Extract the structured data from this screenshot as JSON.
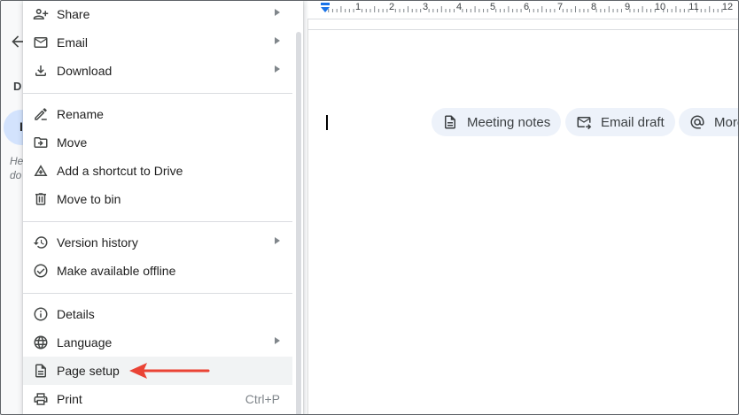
{
  "menu": {
    "items": [
      {
        "label": "Share",
        "icon": "person-add-icon",
        "submenu": true
      },
      {
        "label": "Email",
        "icon": "mail-icon",
        "submenu": true
      },
      {
        "label": "Download",
        "icon": "download-icon",
        "submenu": true
      },
      {
        "label": "Rename",
        "icon": "edit-icon",
        "submenu": false
      },
      {
        "label": "Move",
        "icon": "folder-move-icon",
        "submenu": false
      },
      {
        "label": "Add a shortcut to Drive",
        "icon": "drive-shortcut-icon",
        "submenu": false
      },
      {
        "label": "Move to bin",
        "icon": "trash-icon",
        "submenu": false
      },
      {
        "label": "Version history",
        "icon": "history-icon",
        "submenu": true
      },
      {
        "label": "Make available offline",
        "icon": "offline-check-icon",
        "submenu": false
      },
      {
        "label": "Details",
        "icon": "info-icon",
        "submenu": false
      },
      {
        "label": "Language",
        "icon": "globe-icon",
        "submenu": true
      },
      {
        "label": "Page setup",
        "icon": "page-icon",
        "submenu": false,
        "highlighted": true
      },
      {
        "label": "Print",
        "icon": "print-icon",
        "submenu": false,
        "shortcut": "Ctrl+P"
      }
    ]
  },
  "ruler": {
    "numbers": [
      "1",
      "2",
      "3",
      "4",
      "5",
      "6",
      "7",
      "8",
      "9",
      "10",
      "11",
      "12"
    ]
  },
  "chips": [
    {
      "label": "Meeting notes",
      "icon": "document-icon"
    },
    {
      "label": "Email draft",
      "icon": "email-send-icon"
    },
    {
      "label": "More",
      "icon": "at-icon"
    }
  ],
  "left_panel": {
    "letter": "D",
    "bubble_letter": "I",
    "hint_line1": "He",
    "hint_line2": "do"
  },
  "colors": {
    "annotation_arrow": "#ea4335",
    "chip_bg": "#edf2fa",
    "ruler_indent": "#1a73e8"
  }
}
